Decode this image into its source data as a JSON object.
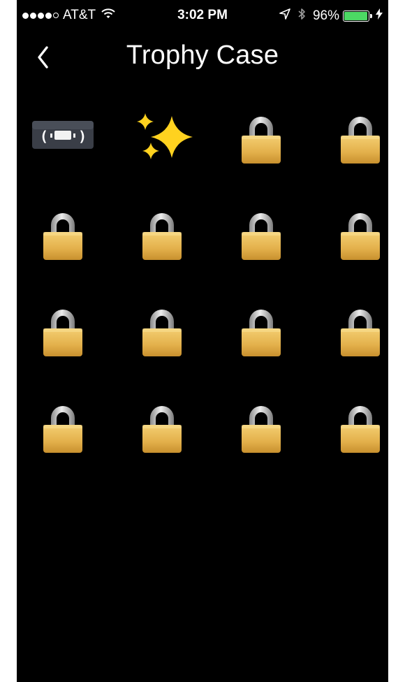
{
  "status_bar": {
    "carrier": "AT&T",
    "time": "3:02 PM",
    "battery_percent": "96%",
    "battery_level": 0.96,
    "signal_bars": 4,
    "signal_total": 5,
    "icons": [
      "signal-dots-icon",
      "wifi-icon",
      "location-arrow-icon",
      "bluetooth-icon",
      "battery-icon",
      "charging-bolt-icon"
    ]
  },
  "nav": {
    "back_icon": "chevron-left-icon",
    "title": "Trophy Case"
  },
  "colors": {
    "background": "#000000",
    "battery_fill": "#4cd964",
    "lock_body": "#e3b04b",
    "lock_shackle": "#c8c8c8",
    "sparkle": "#ffd21f"
  },
  "trophies": [
    {
      "icon": "cassette-tape-icon",
      "unlocked": true
    },
    {
      "icon": "sparkles-icon",
      "unlocked": true
    },
    {
      "icon": "lock-icon",
      "unlocked": false
    },
    {
      "icon": "lock-icon",
      "unlocked": false
    },
    {
      "icon": "lock-icon",
      "unlocked": false
    },
    {
      "icon": "lock-icon",
      "unlocked": false
    },
    {
      "icon": "lock-icon",
      "unlocked": false
    },
    {
      "icon": "lock-icon",
      "unlocked": false
    },
    {
      "icon": "lock-icon",
      "unlocked": false
    },
    {
      "icon": "lock-icon",
      "unlocked": false
    },
    {
      "icon": "lock-icon",
      "unlocked": false
    },
    {
      "icon": "lock-icon",
      "unlocked": false
    },
    {
      "icon": "lock-icon",
      "unlocked": false
    },
    {
      "icon": "lock-icon",
      "unlocked": false
    },
    {
      "icon": "lock-icon",
      "unlocked": false
    },
    {
      "icon": "lock-icon",
      "unlocked": false
    }
  ]
}
